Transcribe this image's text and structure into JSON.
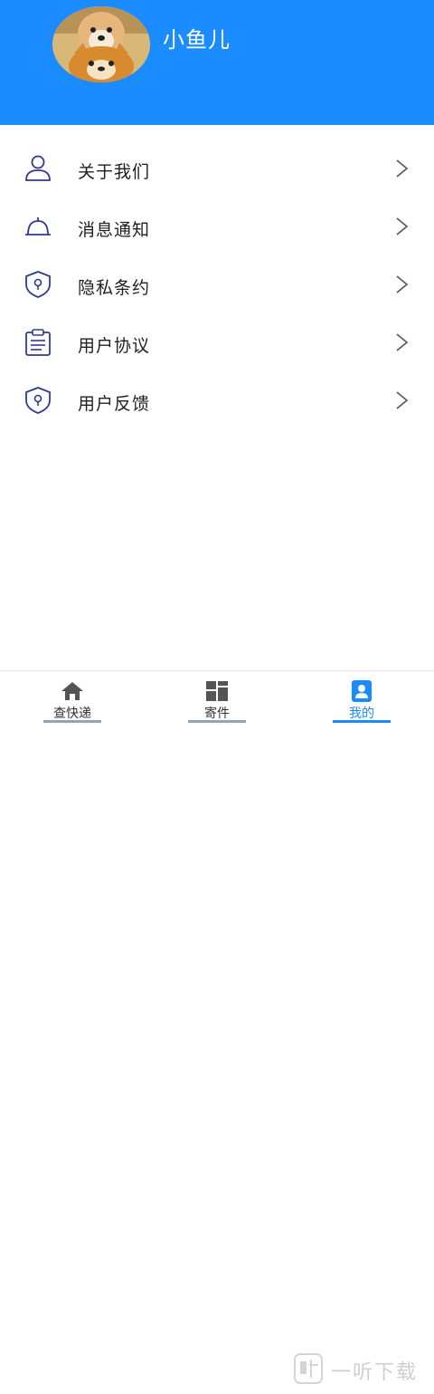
{
  "header": {
    "username": "小鱼儿",
    "avatar_icon": "shiba-dog-avatar",
    "background_color": "#1a8cff"
  },
  "menu": {
    "items": [
      {
        "label": "关于我们",
        "icon": "person-icon"
      },
      {
        "label": "消息通知",
        "icon": "bell-icon"
      },
      {
        "label": "隐私条约",
        "icon": "shield-icon"
      },
      {
        "label": "用户协议",
        "icon": "clipboard-icon"
      },
      {
        "label": "用户反馈",
        "icon": "shield-icon"
      }
    ],
    "icon_color": "#2f3a8f"
  },
  "tabbar": {
    "tabs": [
      {
        "label": "查快递",
        "icon": "home-icon",
        "active": false
      },
      {
        "label": "寄件",
        "icon": "grid-icon",
        "active": false
      },
      {
        "label": "我的",
        "icon": "profile-icon",
        "active": true
      }
    ],
    "active_color": "#1a8cff"
  },
  "watermark": {
    "text": "一听下载"
  }
}
